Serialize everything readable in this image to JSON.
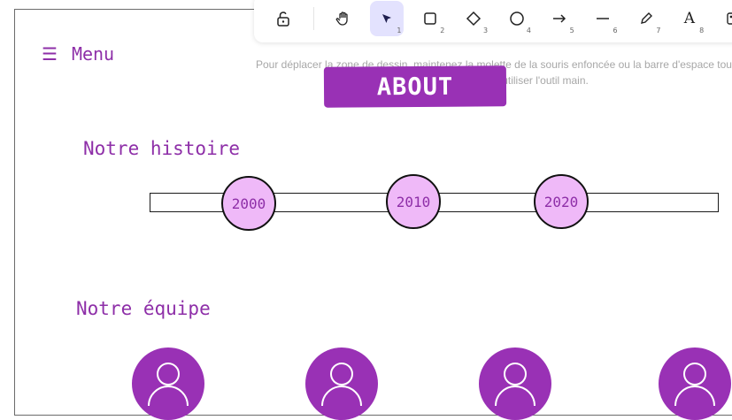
{
  "toolbar": {
    "tools": [
      {
        "icon": "lock-icon",
        "glyph": "🔓",
        "key": ""
      },
      {
        "icon": "hand-icon",
        "glyph": "✋",
        "key": ""
      },
      {
        "icon": "selection-arrow-icon",
        "glyph": "➤",
        "key": "1",
        "active": true
      },
      {
        "icon": "rectangle-icon",
        "glyph": "▢",
        "key": "2"
      },
      {
        "icon": "diamond-icon",
        "glyph": "◇",
        "key": "3"
      },
      {
        "icon": "ellipse-icon",
        "glyph": "○",
        "key": "4"
      },
      {
        "icon": "arrow-icon",
        "glyph": "→",
        "key": "5"
      },
      {
        "icon": "line-icon",
        "glyph": "—",
        "key": "6"
      },
      {
        "icon": "pencil-icon",
        "glyph": "✎",
        "key": "7"
      },
      {
        "icon": "text-icon",
        "glyph": "A",
        "key": "8"
      },
      {
        "icon": "image-icon",
        "glyph": "▣",
        "key": ""
      }
    ]
  },
  "hint": "Pour déplacer la zone de dessin, maintenez la molette de la souris enfoncée ou la barre d'espace tout en faisant glisser, ou utiliser l'outil main.",
  "menu": {
    "label": "Menu"
  },
  "about": {
    "label": "ABOUT"
  },
  "history": {
    "title": "Notre histoire",
    "years": [
      "2000",
      "2010",
      "2020"
    ]
  },
  "team": {
    "title": "Notre équipe",
    "member_count": 4
  },
  "colors": {
    "accent": "#9931b5",
    "year_fill": "#efb9f8",
    "selected_tool": "#e3e2fe"
  }
}
